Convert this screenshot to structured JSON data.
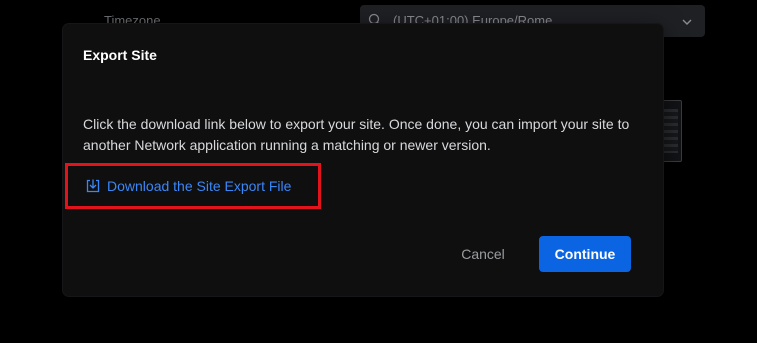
{
  "background": {
    "setting_label": "Timezone",
    "timezone_select": {
      "value": "(UTC+01:00) Europe/Rome",
      "icon": "search-icon",
      "chevron": "chevron-down-icon"
    }
  },
  "modal": {
    "title": "Export Site",
    "body_text": "Click the download link below to export your site. Once done, you can import your site to another Network application running a matching or newer version.",
    "download_link": {
      "label": "Download the Site Export File",
      "icon": "download-icon",
      "color": "#3b87f7"
    },
    "highlight_color": "#e3131b",
    "buttons": {
      "cancel_label": "Cancel",
      "continue_label": "Continue",
      "continue_color": "#0b65e3"
    }
  }
}
